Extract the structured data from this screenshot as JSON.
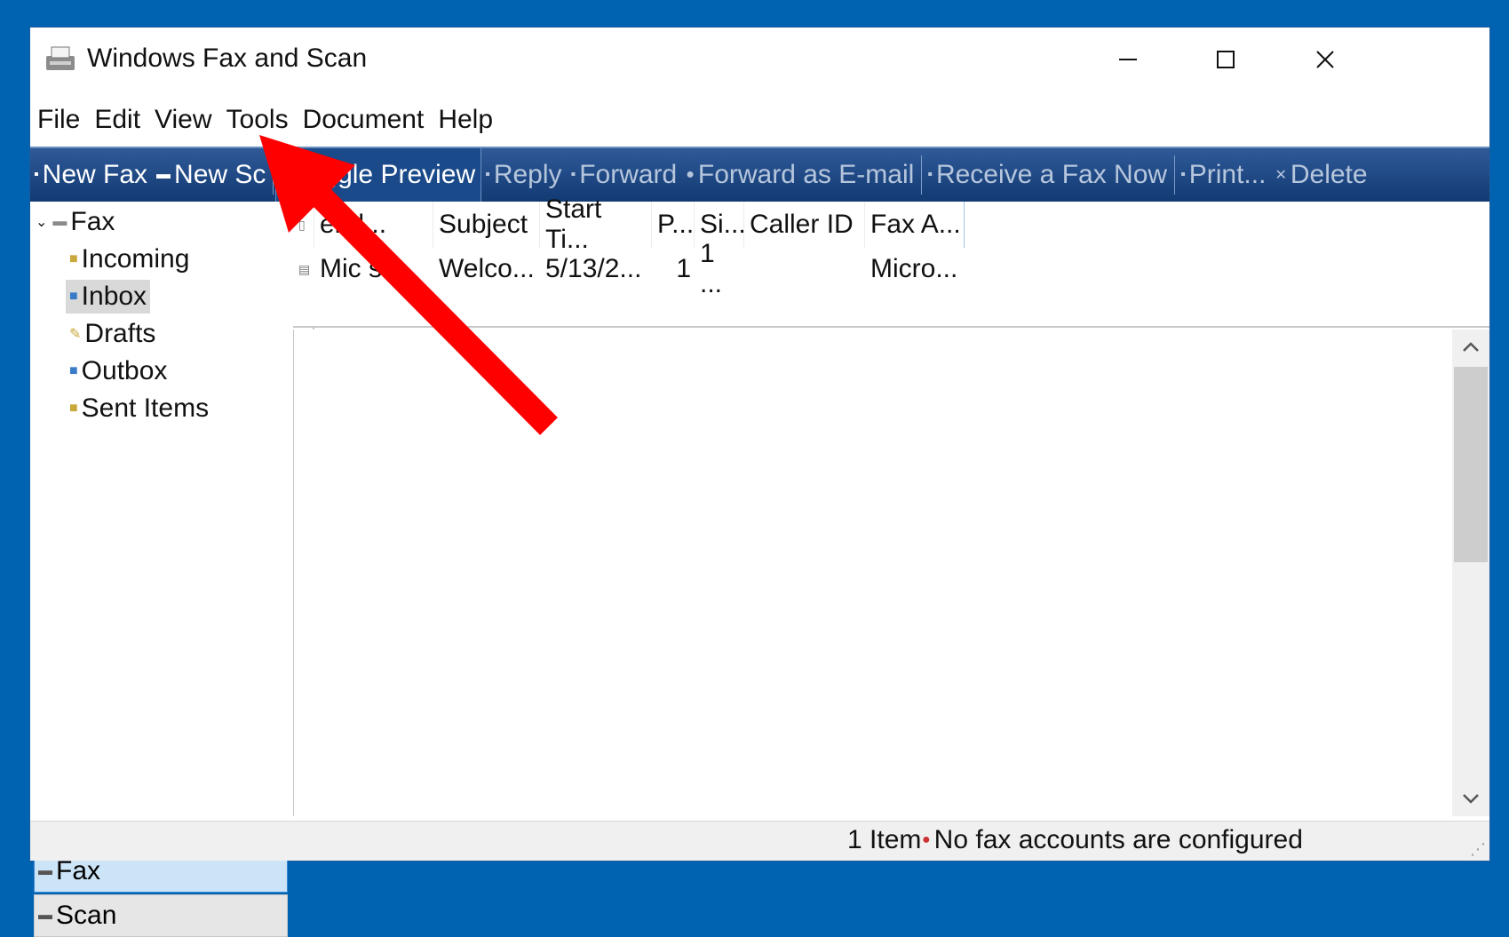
{
  "window": {
    "title": "Windows Fax and Scan",
    "controls": {
      "minimize": "—",
      "maximize": "☐",
      "close": "✕"
    }
  },
  "menu": [
    "File",
    "Edit",
    "View",
    "Tools",
    "Document",
    "Help"
  ],
  "toolbar": {
    "new_fax": "New Fax",
    "new_scan": "New Sc",
    "toggle_preview": "Toggle Preview",
    "reply": "Reply",
    "forward": "Forward",
    "forward_email": "Forward as E-mail",
    "receive": "Receive a Fax Now",
    "print": "Print...",
    "delete": "Delete"
  },
  "tree": {
    "root": "Fax",
    "items": [
      "Incoming",
      "Inbox",
      "Drafts",
      "Outbox",
      "Sent Items"
    ],
    "selected": "Inbox"
  },
  "nav": {
    "fax": "Fax",
    "scan": "Scan"
  },
  "list": {
    "columns": [
      "end...",
      "Subject",
      "Start Ti...",
      "P...",
      "Si...",
      "Caller ID",
      "Fax A..."
    ],
    "row": [
      "Mic   s...",
      "Welco...",
      "5/13/2...",
      "1",
      "1 ...",
      "",
      "Micro..."
    ]
  },
  "status": {
    "count": "1 Item",
    "message": "No fax accounts are configured"
  },
  "colors": {
    "toolbar": "#1f4a86",
    "desktop": "#0063b1",
    "arrow": "#ff0000"
  }
}
